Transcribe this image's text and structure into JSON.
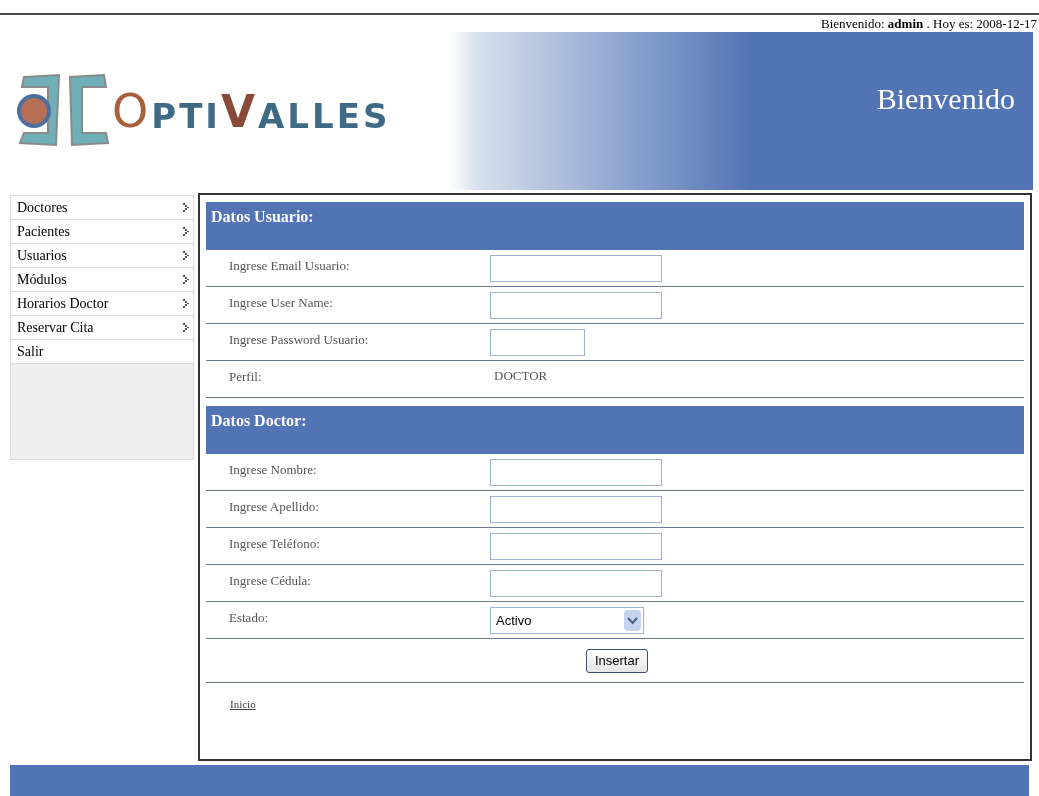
{
  "welcome": "Bienvenido: **admin** . Hoy es: 2008-12-17",
  "logo": [
    {
      "text": "O",
      "color": "#a8603a"
    },
    {
      "text": "PTI",
      "color": "#3f6a86"
    },
    {
      "text": "V",
      "color": "#8a4a3a"
    },
    {
      "text": "ALLES",
      "color": "#3f6a86"
    }
  ],
  "banner_title": "Bienvenido",
  "sidebar": {
    "items": [
      {
        "label": "Doctores",
        "submenu": true
      },
      {
        "label": "Pacientes",
        "submenu": true
      },
      {
        "label": "Usuarios",
        "submenu": true
      },
      {
        "label": "Módulos",
        "submenu": true
      },
      {
        "label": "Horarios Doctor",
        "submenu": true
      },
      {
        "label": "Reservar Cita",
        "submenu": true
      },
      {
        "label": "Salir",
        "submenu": false
      }
    ]
  },
  "sections": [
    {
      "title": "Datos Usuario:",
      "rows": [
        {
          "label": "Ingrese Email Usuario:",
          "kind": "input"
        },
        {
          "label": "Ingrese User Name:",
          "kind": "input"
        },
        {
          "label": "Ingrese Password Usuario:",
          "kind": "password"
        },
        {
          "label": "Perfil:",
          "kind": "text",
          "value": "DOCTOR"
        }
      ]
    },
    {
      "title": "Datos Doctor:",
      "rows": [
        {
          "label": "Ingrese Nombre:",
          "kind": "input"
        },
        {
          "label": "Ingrese Apellido:",
          "kind": "input"
        },
        {
          "label": "Ingrese Teléfono:",
          "kind": "input"
        },
        {
          "label": "Ingrese Cédula:",
          "kind": "input"
        },
        {
          "label": "Estado:",
          "kind": "select",
          "value": "Activo"
        }
      ]
    }
  ],
  "submit_button": "Insertar",
  "home_link": "Inicio"
}
